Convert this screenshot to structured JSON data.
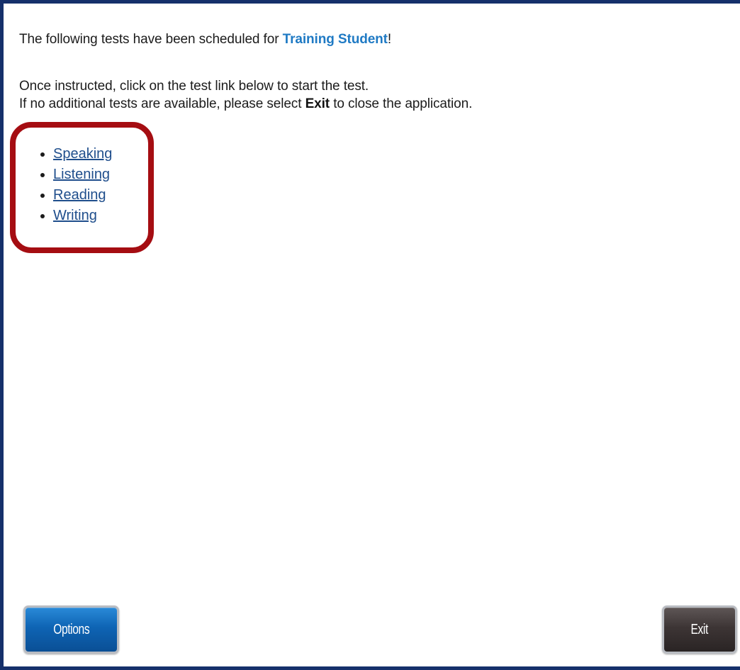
{
  "header": {
    "intro_prefix": "The following tests have been scheduled for ",
    "student_name": "Training Student",
    "intro_suffix": "!"
  },
  "instructions": {
    "line1": "Once instructed, click on the test link below to start the test.",
    "line2_prefix": "If no additional tests are available, please select ",
    "line2_bold": "Exit",
    "line2_suffix": " to close the application."
  },
  "tests": [
    {
      "label": "Speaking"
    },
    {
      "label": "Listening"
    },
    {
      "label": "Reading"
    },
    {
      "label": "Writing"
    }
  ],
  "footer": {
    "options_label": "Options",
    "exit_label": "Exit"
  },
  "colors": {
    "frame_border": "#15306b",
    "highlight_box": "#a50d12",
    "student_name": "#1f7ac4",
    "link": "#1f4e8c",
    "options_button": "#0e64b4",
    "exit_button": "#3d3535"
  }
}
